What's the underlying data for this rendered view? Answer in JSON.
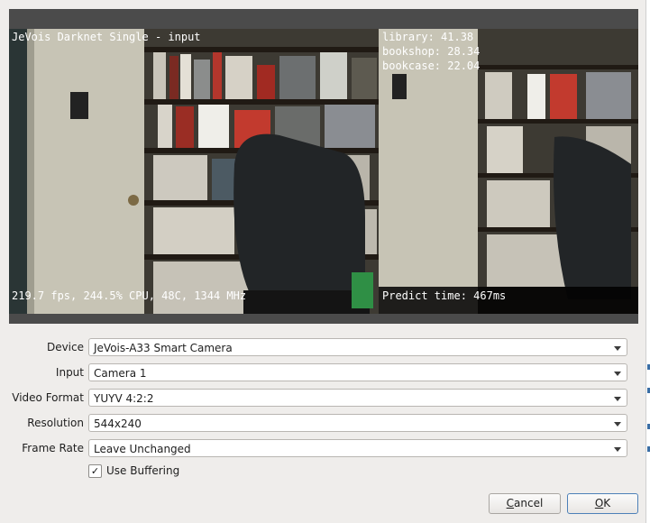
{
  "preview": {
    "title_overlay": "JeVois Darknet Single - input",
    "stats_overlay": "219.7 fps, 244.5% CPU, 48C, 1344 MHz",
    "predictions": [
      "library: 41.38",
      "bookshop: 28.34",
      "bookcase: 22.04"
    ],
    "predict_time": "Predict time: 467ms"
  },
  "form": {
    "device": {
      "label": "Device",
      "value": "JeVois-A33 Smart Camera"
    },
    "input": {
      "label": "Input",
      "value": "Camera 1"
    },
    "video_format": {
      "label": "Video Format",
      "value": "YUYV 4:2:2"
    },
    "resolution": {
      "label": "Resolution",
      "value": "544x240"
    },
    "frame_rate": {
      "label": "Frame Rate",
      "value": "Leave Unchanged"
    },
    "use_buffering": {
      "label": "Use Buffering",
      "checked": true,
      "mark": "✓"
    }
  },
  "buttons": {
    "cancel": {
      "accel": "C",
      "rest": "ancel"
    },
    "ok": {
      "accel": "O",
      "rest": "K"
    }
  },
  "colors": {
    "accent": "#4d80b8",
    "frame": "#4b4b4b",
    "background": "#efedeb"
  }
}
